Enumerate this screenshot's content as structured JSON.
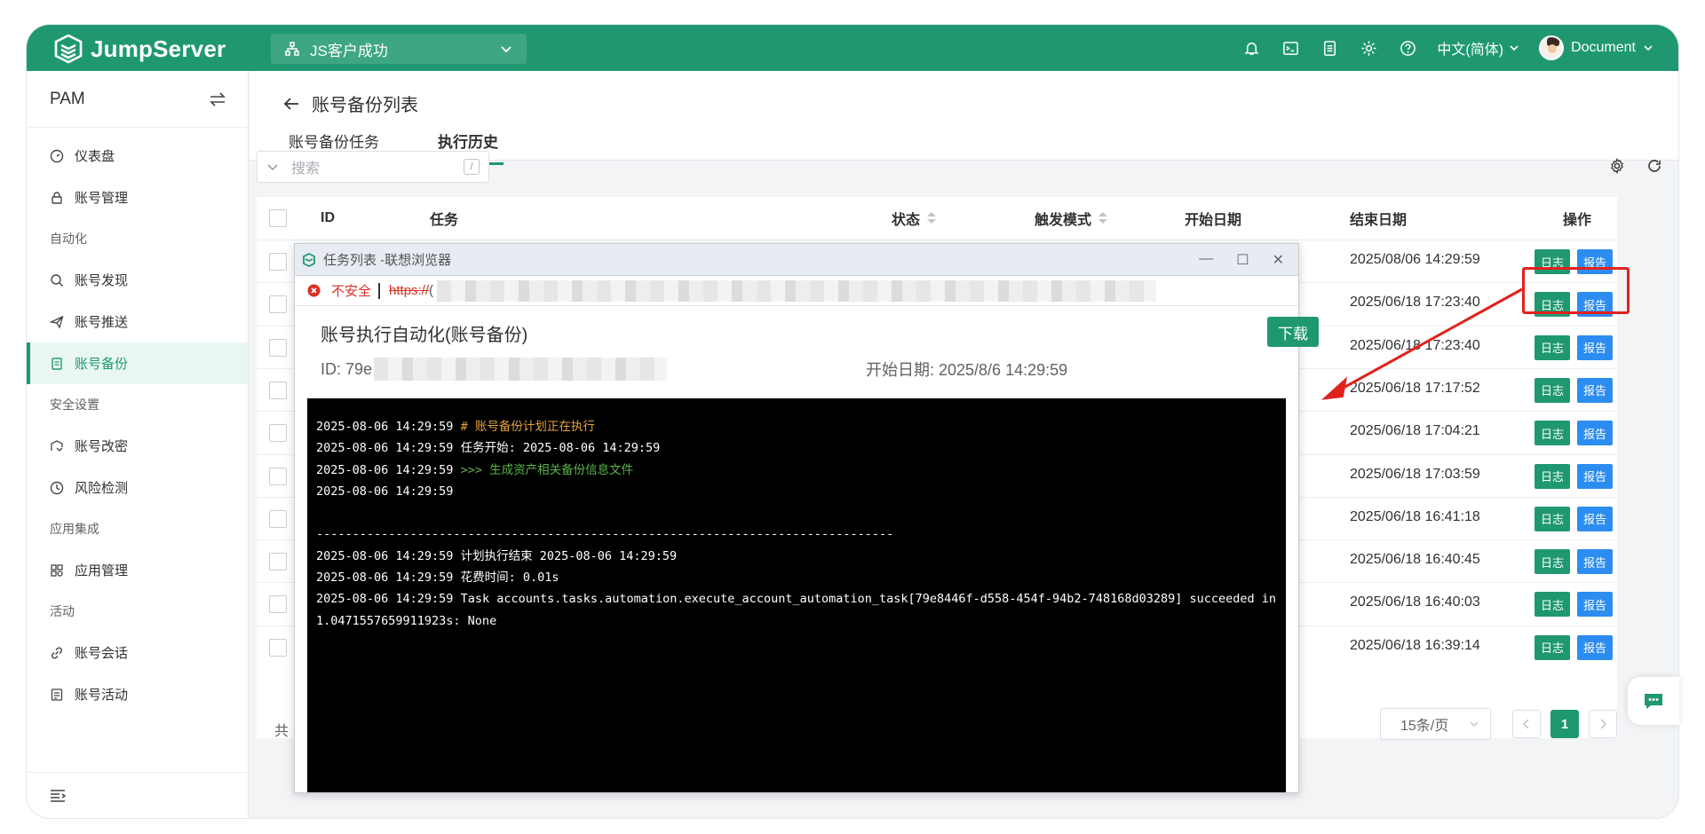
{
  "brand": {
    "name": "JumpServer",
    "color": "#1f9872"
  },
  "topbar": {
    "org": "JS客户成功",
    "language": "中文(简体)",
    "user": "Document",
    "icons": [
      "bell-icon",
      "terminal-icon",
      "tickets-icon",
      "settings-icon",
      "help-icon"
    ]
  },
  "sidebar": {
    "title": "PAM",
    "items": [
      {
        "label": "仪表盘",
        "icon": "dashboard-icon"
      },
      {
        "label": "账号管理",
        "icon": "lock-icon"
      },
      {
        "group": "自动化"
      },
      {
        "label": "账号发现",
        "icon": "search-icon"
      },
      {
        "label": "账号推送",
        "icon": "send-icon"
      },
      {
        "label": "账号备份",
        "icon": "backup-icon",
        "active": true
      },
      {
        "group": "安全设置"
      },
      {
        "label": "账号改密",
        "icon": "key-change-icon"
      },
      {
        "label": "风险检测",
        "icon": "risk-icon"
      },
      {
        "group": "应用集成"
      },
      {
        "label": "应用管理",
        "icon": "apps-icon"
      },
      {
        "group": "活动"
      },
      {
        "label": "账号会话",
        "icon": "link-icon"
      },
      {
        "label": "账号活动",
        "icon": "activity-icon"
      }
    ]
  },
  "page": {
    "title": "账号备份列表",
    "tabs": [
      {
        "label": "账号备份任务",
        "active": false
      },
      {
        "label": "执行历史",
        "active": true
      }
    ],
    "search_placeholder": "搜索",
    "search_shortcut": "/"
  },
  "table": {
    "columns": [
      "ID",
      "任务",
      "状态",
      "触发模式",
      "开始日期",
      "结束日期",
      "操作"
    ],
    "log_label": "日志",
    "report_label": "报告",
    "end_dates": [
      "2025/08/06 14:29:59",
      "2025/06/18 17:23:40",
      "2025/06/18 17:23:40",
      "2025/06/18 17:17:52",
      "2025/06/18 17:04:21",
      "2025/06/18 17:03:59",
      "2025/06/18 16:41:18",
      "2025/06/18 16:40:45",
      "2025/06/18 16:40:03",
      "2025/06/18 16:39:14"
    ],
    "total_prefix": "共",
    "page_size": "15条/页",
    "current_page": "1"
  },
  "popup": {
    "window_title": "任务列表 -联想浏览器",
    "insecure_label": "不安全",
    "url_prefix": "https://",
    "url_tail": "(",
    "heading": "账号执行自动化(账号备份)",
    "download_label": "下载",
    "id_label": "ID: 79e",
    "start_label": "开始日期: 2025/8/6 14:29:59",
    "log_lines": [
      {
        "ts": "2025-08-06 14:29:59",
        "text": "# 账号备份计划正在执行",
        "color": "#e6a23c"
      },
      {
        "ts": "2025-08-06 14:29:59",
        "text": "任务开始: 2025-08-06 14:29:59",
        "color": "#ffffff"
      },
      {
        "ts": "2025-08-06 14:29:59",
        "text": ">>> 生成资产相关备份信息文件",
        "color": "#5bb34a"
      },
      {
        "ts": "2025-08-06 14:29:59",
        "text": "",
        "color": "#ffffff"
      },
      {
        "ts": "",
        "text": "",
        "color": "#ffffff"
      },
      {
        "ts": "",
        "text": "--------------------------------------------------------------------------------",
        "color": "#ffffff"
      },
      {
        "ts": "2025-08-06 14:29:59",
        "text": "计划执行结束 2025-08-06 14:29:59",
        "color": "#ffffff"
      },
      {
        "ts": "2025-08-06 14:29:59",
        "text": "花费时间: 0.01s",
        "color": "#ffffff"
      },
      {
        "ts": "2025-08-06 14:29:59",
        "text": "Task accounts.tasks.automation.execute_account_automation_task[79e8446f-d558-454f-94b2-748168d03289] succeeded in 1.0471557659911923s: None",
        "color": "#ffffff"
      }
    ]
  },
  "annotation_color": "#e0221c"
}
